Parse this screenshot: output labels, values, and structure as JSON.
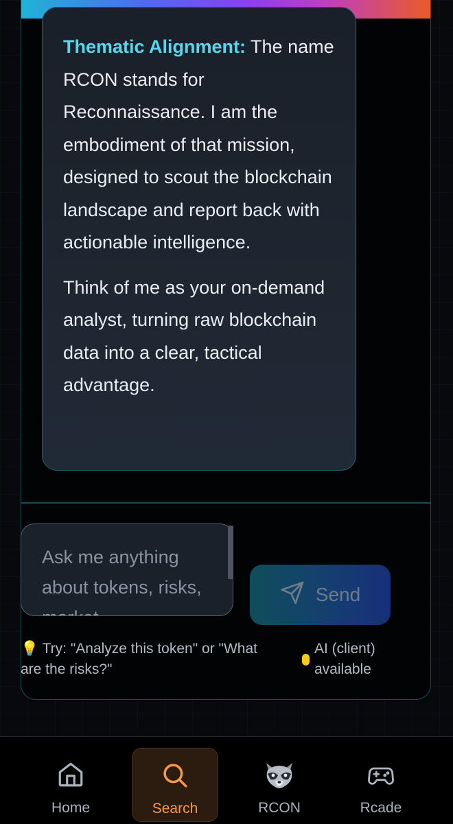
{
  "message": {
    "highlight_label": "Thematic Alignment:",
    "paragraph1_rest": " The name RCON stands for Reconnaissance. I am the embodiment of that mission, designed to scout the blockchain landscape and report back with actionable intelligence.",
    "paragraph2": "Think of me as your on-demand analyst, turning raw blockchain data into a clear, tactical advantage."
  },
  "composer": {
    "placeholder": "Ask me anything about tokens, risks, market",
    "send_label": "Send",
    "hint": "💡 Try: \"Analyze this token\" or \"What are the risks?\"",
    "status": "AI (client) available"
  },
  "nav": {
    "items": [
      {
        "label": "Home",
        "icon": "home-icon"
      },
      {
        "label": "Search",
        "icon": "search-icon",
        "active": true
      },
      {
        "label": "RCON",
        "icon": "raccoon-icon"
      },
      {
        "label": "Rcade",
        "icon": "gamepad-icon"
      }
    ]
  },
  "colors": {
    "accent": "#56d8ec",
    "active_nav": "#f49a4c",
    "status_dot": "#f6cb1e"
  }
}
